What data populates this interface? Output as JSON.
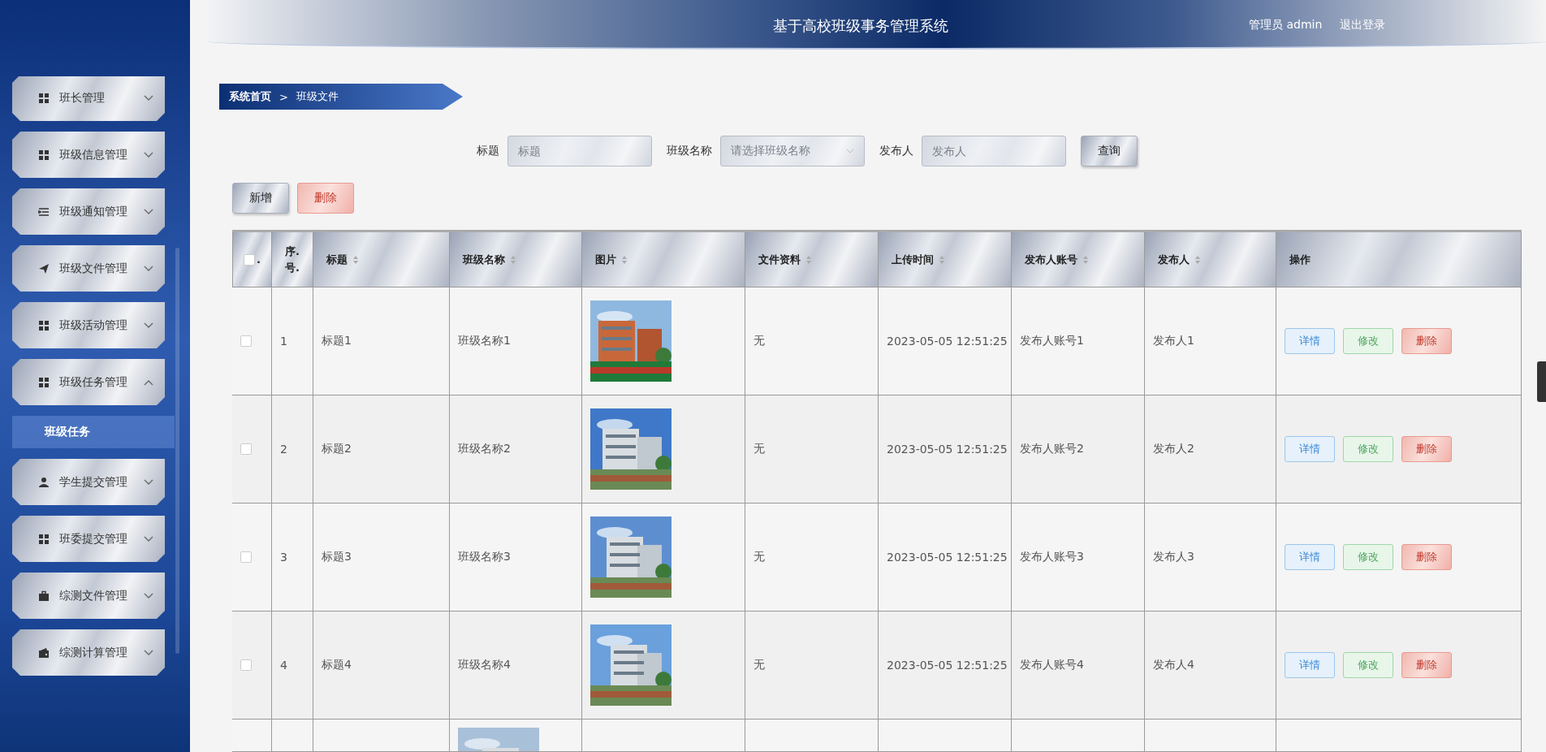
{
  "header": {
    "title": "基于高校班级事务管理系统",
    "user": "管理员 admin",
    "logout": "退出登录"
  },
  "sidebar": {
    "items": [
      {
        "label": "班长管理",
        "kind": "grid",
        "expanded": false
      },
      {
        "label": "班级信息管理",
        "kind": "grid",
        "expanded": false
      },
      {
        "label": "班级通知管理",
        "kind": "list",
        "expanded": false
      },
      {
        "label": "班级文件管理",
        "kind": "send",
        "expanded": false
      },
      {
        "label": "班级活动管理",
        "kind": "grid",
        "expanded": false
      },
      {
        "label": "班级任务管理",
        "kind": "grid",
        "expanded": true,
        "children": [
          {
            "label": "班级任务",
            "selected": true
          }
        ]
      },
      {
        "label": "学生提交管理",
        "kind": "user",
        "expanded": false
      },
      {
        "label": "班委提交管理",
        "kind": "grid",
        "expanded": false
      },
      {
        "label": "综测文件管理",
        "kind": "case",
        "expanded": false
      },
      {
        "label": "综测计算管理",
        "kind": "wallet",
        "expanded": false
      }
    ]
  },
  "breadcrumb": [
    "系统首页",
    ">",
    "班级文件"
  ],
  "search": {
    "fields": [
      {
        "label": "标题",
        "placeholder": "标题",
        "kind": "input"
      },
      {
        "label": "班级名称",
        "placeholder": "请选择班级名称",
        "kind": "select"
      },
      {
        "label": "发布人",
        "placeholder": "发布人",
        "kind": "input"
      }
    ],
    "button": "查询"
  },
  "actions": [
    {
      "label": "新增",
      "kind": "default"
    },
    {
      "label": "删除",
      "kind": "danger"
    }
  ],
  "table": {
    "select_all": {
      "checked": false,
      "mark": "."
    },
    "columns": [
      {
        "label": "序.号.",
        "sortable": false
      },
      {
        "label": "标题",
        "sortable": true
      },
      {
        "label": "班级名称",
        "sortable": true
      },
      {
        "label": "图片",
        "sortable": true
      },
      {
        "label": "文件资料",
        "sortable": true
      },
      {
        "label": "上传时间",
        "sortable": true
      },
      {
        "label": "发布人账号",
        "sortable": true
      },
      {
        "label": "发布人",
        "sortable": true
      },
      {
        "label": "操作",
        "sortable": false
      }
    ],
    "rows": [
      {
        "kind": "full",
        "checked": false,
        "cells": [
          "1",
          "标题1",
          "班级名称1",
          "无",
          "2023-05-05 12:51:25",
          "发布人账号1",
          "发布人1"
        ],
        "buttons": [
          {
            "label": "详情",
            "kind": "info"
          },
          {
            "label": "修改",
            "kind": "edit"
          },
          {
            "label": "删除",
            "kind": "danger"
          }
        ]
      },
      {
        "kind": "full",
        "checked": false,
        "cells": [
          "2",
          "标题2",
          "班级名称2",
          "无",
          "2023-05-05 12:51:25",
          "发布人账号2",
          "发布人2"
        ],
        "buttons": [
          {
            "label": "详情",
            "kind": "info"
          },
          {
            "label": "修改",
            "kind": "edit"
          },
          {
            "label": "删除",
            "kind": "danger"
          }
        ]
      },
      {
        "kind": "full",
        "checked": false,
        "cells": [
          "3",
          "标题3",
          "班级名称3",
          "无",
          "2023-05-05 12:51:25",
          "发布人账号3",
          "发布人3"
        ],
        "buttons": [
          {
            "label": "详情",
            "kind": "info"
          },
          {
            "label": "修改",
            "kind": "edit"
          },
          {
            "label": "删除",
            "kind": "danger"
          }
        ]
      },
      {
        "kind": "full",
        "checked": false,
        "cells": [
          "4",
          "标题4",
          "班级名称4",
          "无",
          "2023-05-05 12:51:25",
          "发布人账号4",
          "发布人4"
        ],
        "buttons": [
          {
            "label": "详情",
            "kind": "info"
          },
          {
            "label": "修改",
            "kind": "edit"
          },
          {
            "label": "删除",
            "kind": "danger"
          }
        ]
      },
      {
        "kind": "partial"
      }
    ]
  }
}
